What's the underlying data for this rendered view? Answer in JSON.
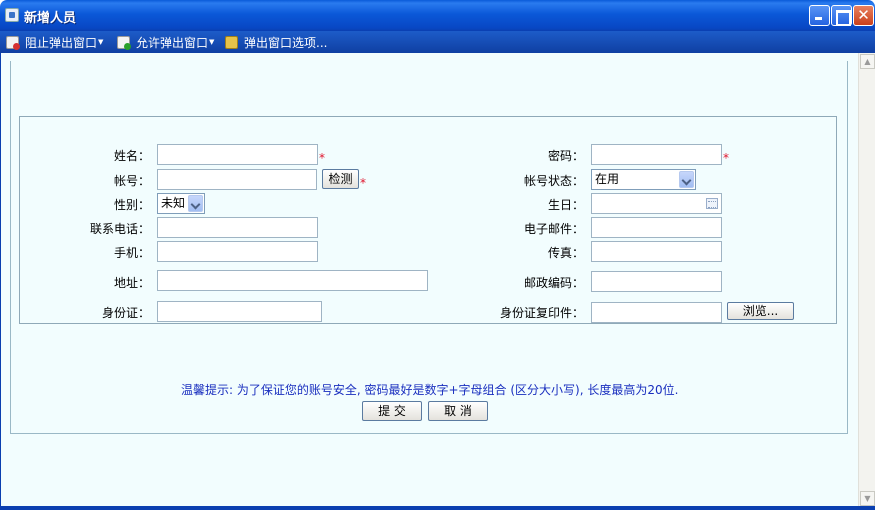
{
  "window": {
    "title": "新增人员"
  },
  "toolbar": {
    "block_popup": "阻止弹出窗口",
    "allow_popup": "允许弹出窗口",
    "popup_options": "弹出窗口选项..."
  },
  "form": {
    "name_label": "姓名：",
    "account_label": "帐号：",
    "check_button": "检测",
    "gender_label": "性别：",
    "gender_value": "未知",
    "phone_label": "联系电话：",
    "mobile_label": "手机：",
    "address_label": "地址：",
    "id_card_label": "身份证：",
    "password_label": "密码：",
    "account_status_label": "帐号状态：",
    "account_status_value": "在用",
    "birthday_label": "生日：",
    "email_label": "电子邮件：",
    "fax_label": "传真：",
    "postcode_label": "邮政编码：",
    "id_copy_label": "身份证复印件：",
    "browse_button": "浏览...",
    "required_mark": "*"
  },
  "hint": "温馨提示: 为了保证您的账号安全, 密码最好是数字+字母组合 (区分大小写), 长度最高为20位.",
  "actions": {
    "submit": "提 交",
    "cancel": "取 消"
  }
}
